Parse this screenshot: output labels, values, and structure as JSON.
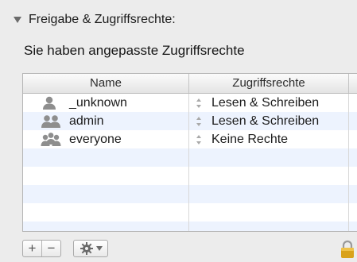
{
  "section": {
    "title": "Freigabe & Zugriffsrechte:",
    "subtitle": "Sie haben angepasste Zugriffsrechte"
  },
  "table": {
    "columns": {
      "name": "Name",
      "permissions": "Zugriffsrechte"
    },
    "rows": [
      {
        "name": "_unknown",
        "permission": "Lesen & Schreiben",
        "icon": "single-user-icon"
      },
      {
        "name": "admin",
        "permission": "Lesen & Schreiben",
        "icon": "group-icon"
      },
      {
        "name": "everyone",
        "permission": "Keine Rechte",
        "icon": "everyone-group-icon"
      }
    ]
  },
  "toolbar": {
    "add_label": "+",
    "remove_label": "−",
    "action_icon": "gear-icon",
    "lock_icon": "lock-icon"
  },
  "colors": {
    "alternate_row": "#edf3fe",
    "user_icon": "#8e8e8e",
    "lock": "#d9a21a"
  }
}
